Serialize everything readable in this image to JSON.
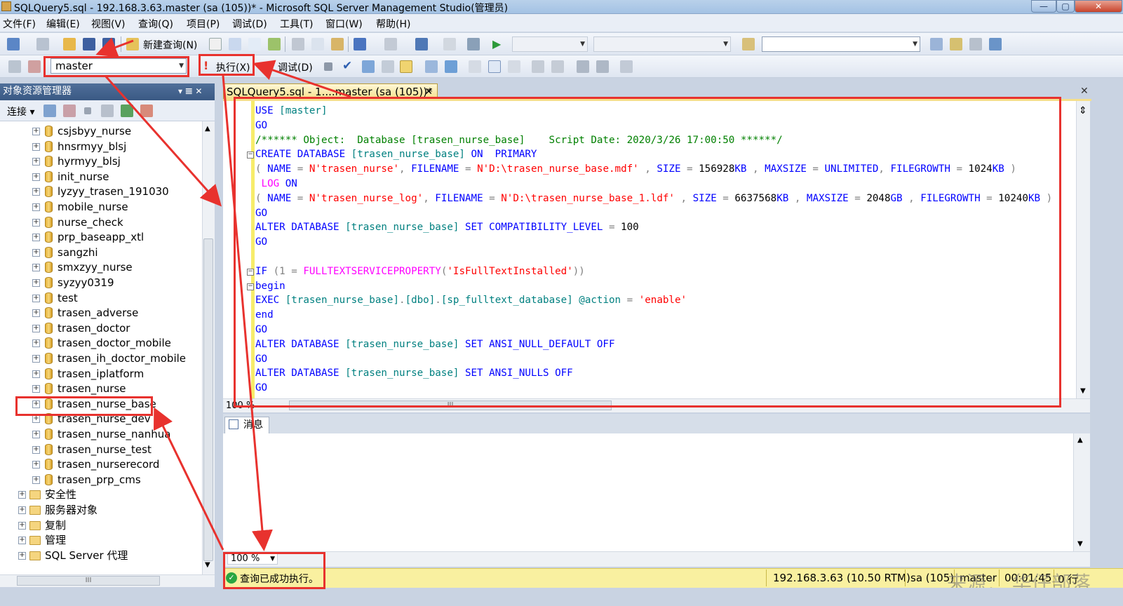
{
  "window": {
    "title": "SQLQuery5.sql - 192.168.3.63.master (sa (105))* - Microsoft SQL Server Management Studio(管理员)",
    "min": "—",
    "max": "▢",
    "close": "✕"
  },
  "menu": [
    "文件(F)",
    "编辑(E)",
    "视图(V)",
    "查询(Q)",
    "项目(P)",
    "调试(D)",
    "工具(T)",
    "窗口(W)",
    "帮助(H)"
  ],
  "toolbar": {
    "new_query": "新建查询(N)",
    "database": "master",
    "execute": "执行(X)",
    "debug": "调试(D)"
  },
  "object_explorer": {
    "title": "对象资源管理器",
    "header_controls": "▾ 𝌆 ✕",
    "connect": "连接",
    "databases": [
      "csjsbyy_nurse",
      "hnsrmyy_blsj",
      "hyrmyy_blsj",
      "init_nurse",
      "lyzyy_trasen_191030",
      "mobile_nurse",
      "nurse_check",
      "prp_baseapp_xtl",
      "sangzhi",
      "smxzyy_nurse",
      "syzyy0319",
      "test",
      "trasen_adverse",
      "trasen_doctor",
      "trasen_doctor_mobile",
      "trasen_ih_doctor_mobile",
      "trasen_iplatform",
      "trasen_nurse",
      "trasen_nurse_base",
      "trasen_nurse_dev",
      "trasen_nurse_nanhua",
      "trasen_nurse_test",
      "trasen_nurserecord",
      "trasen_prp_cms"
    ],
    "folders": [
      "安全性",
      "服务器对象",
      "复制",
      "管理",
      "SQL Server 代理"
    ],
    "expander": "+",
    "hscroll_grip": "III"
  },
  "document": {
    "tab_label": "SQLQuery5.sql - 1....master (sa (105))*",
    "close": "✕"
  },
  "editor": {
    "zoom": "100 %",
    "lines": [
      [
        [
          "kw",
          "USE "
        ],
        [
          "obj",
          "[master]"
        ]
      ],
      [
        [
          "kw",
          "GO"
        ]
      ],
      [
        [
          "cmt",
          "/****** Object:  Database [trasen_nurse_base]    Script Date: 2020/3/26 17:00:50 ******/"
        ]
      ],
      [
        [
          "kw",
          "CREATE DATABASE "
        ],
        [
          "obj",
          "[trasen_nurse_base]"
        ],
        [
          "kw",
          " ON  PRIMARY"
        ]
      ],
      [
        [
          "op",
          "( "
        ],
        [
          "kw",
          "NAME"
        ],
        [
          "op",
          " = "
        ],
        [
          "str",
          "N'trasen_nurse'"
        ],
        [
          "op",
          ", "
        ],
        [
          "kw",
          "FILENAME"
        ],
        [
          "op",
          " = "
        ],
        [
          "str",
          "N'D:\\trasen_nurse_base.mdf'"
        ],
        [
          "op",
          " , "
        ],
        [
          "kw",
          "SIZE"
        ],
        [
          "op",
          " = "
        ],
        [
          "num",
          "156928"
        ],
        [
          "kw",
          "KB"
        ],
        [
          "op",
          " , "
        ],
        [
          "kw",
          "MAXSIZE"
        ],
        [
          "op",
          " = "
        ],
        [
          "kw",
          "UNLIMITED"
        ],
        [
          "op",
          ", "
        ],
        [
          "kw",
          "FILEGROWTH"
        ],
        [
          "op",
          " = "
        ],
        [
          "num",
          "1024"
        ],
        [
          "kw",
          "KB"
        ],
        [
          "op",
          " )"
        ]
      ],
      [
        [
          "fn",
          " LOG"
        ],
        [
          "kw",
          " ON"
        ]
      ],
      [
        [
          "op",
          "( "
        ],
        [
          "kw",
          "NAME"
        ],
        [
          "op",
          " = "
        ],
        [
          "str",
          "N'trasen_nurse_log'"
        ],
        [
          "op",
          ", "
        ],
        [
          "kw",
          "FILENAME"
        ],
        [
          "op",
          " = "
        ],
        [
          "str",
          "N'D:\\trasen_nurse_base_1.ldf'"
        ],
        [
          "op",
          " , "
        ],
        [
          "kw",
          "SIZE"
        ],
        [
          "op",
          " = "
        ],
        [
          "num",
          "6637568"
        ],
        [
          "kw",
          "KB"
        ],
        [
          "op",
          " , "
        ],
        [
          "kw",
          "MAXSIZE"
        ],
        [
          "op",
          " = "
        ],
        [
          "num",
          "2048"
        ],
        [
          "kw",
          "GB"
        ],
        [
          "op",
          " , "
        ],
        [
          "kw",
          "FILEGROWTH"
        ],
        [
          "op",
          " = "
        ],
        [
          "num",
          "10240"
        ],
        [
          "kw",
          "KB"
        ],
        [
          "op",
          " )"
        ]
      ],
      [
        [
          "kw",
          "GO"
        ]
      ],
      [
        [
          "kw",
          "ALTER DATABASE "
        ],
        [
          "obj",
          "[trasen_nurse_base]"
        ],
        [
          "kw",
          " SET COMPATIBILITY_LEVEL"
        ],
        [
          "op",
          " = "
        ],
        [
          "num",
          "100"
        ]
      ],
      [
        [
          "kw",
          "GO"
        ]
      ],
      [
        [
          "num",
          ""
        ]
      ],
      [
        [
          "kw",
          "IF "
        ],
        [
          "op",
          "(1 = "
        ],
        [
          "fn",
          "FULLTEXTSERVICEPROPERTY"
        ],
        [
          "op",
          "("
        ],
        [
          "str",
          "'IsFullTextInstalled'"
        ],
        [
          "op",
          "))"
        ]
      ],
      [
        [
          "kw",
          "begin"
        ]
      ],
      [
        [
          "kw",
          "EXEC "
        ],
        [
          "obj",
          "[trasen_nurse_base]"
        ],
        [
          "op",
          "."
        ],
        [
          "obj",
          "[dbo]"
        ],
        [
          "op",
          "."
        ],
        [
          "obj",
          "[sp_fulltext_database]"
        ],
        [
          "var",
          " @action"
        ],
        [
          "op",
          " = "
        ],
        [
          "str",
          "'enable'"
        ]
      ],
      [
        [
          "kw",
          "end"
        ]
      ],
      [
        [
          "kw",
          "GO"
        ]
      ],
      [
        [
          "kw",
          "ALTER DATABASE "
        ],
        [
          "obj",
          "[trasen_nurse_base]"
        ],
        [
          "kw",
          " SET ANSI_NULL_DEFAULT OFF"
        ]
      ],
      [
        [
          "kw",
          "GO"
        ]
      ],
      [
        [
          "kw",
          "ALTER DATABASE "
        ],
        [
          "obj",
          "[trasen_nurse_base]"
        ],
        [
          "kw",
          " SET ANSI_NULLS OFF"
        ]
      ],
      [
        [
          "kw",
          "GO"
        ]
      ]
    ],
    "fold_mark": "−",
    "hscroll_grip": "III"
  },
  "results": {
    "tab_label": "消息",
    "zoom": "100 %"
  },
  "status": {
    "message": "查询已成功执行。",
    "server": "192.168.3.63 (10.50 RTM)",
    "user": "sa (105)",
    "database": "master",
    "elapsed": "00:01:45",
    "rows": "0 行",
    "ok_mark": "✓"
  },
  "watermark": "来源：  华仔部落",
  "colors": {
    "annotation": "#e8322e",
    "status_bar": "#f9f0a0",
    "explorer_header": "#3a5984"
  }
}
